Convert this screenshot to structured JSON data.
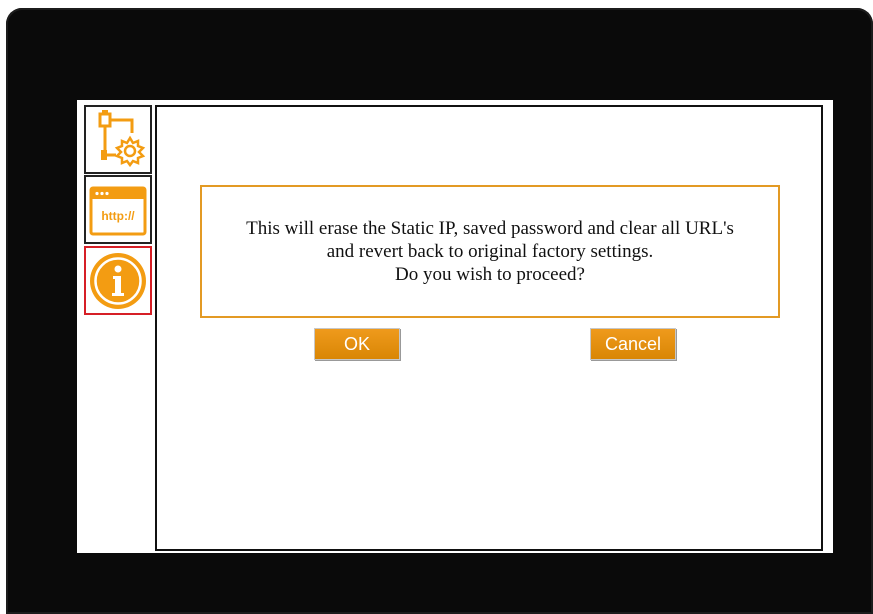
{
  "sidebar": {
    "items": [
      {
        "icon": "network-settings-icon",
        "active": false
      },
      {
        "icon": "url-browser-icon",
        "label": "http://",
        "active": false
      },
      {
        "icon": "info-icon",
        "active": true
      }
    ]
  },
  "dialog": {
    "line1": "This will erase the Static IP, saved password and clear all URL's",
    "line2": "and revert back to original factory settings.",
    "line3": "Do you wish to proceed?",
    "ok_label": "OK",
    "cancel_label": "Cancel"
  },
  "colors": {
    "accent": "#F39C12",
    "active_border": "#D61F26",
    "bezel": "#0A0A0A"
  }
}
